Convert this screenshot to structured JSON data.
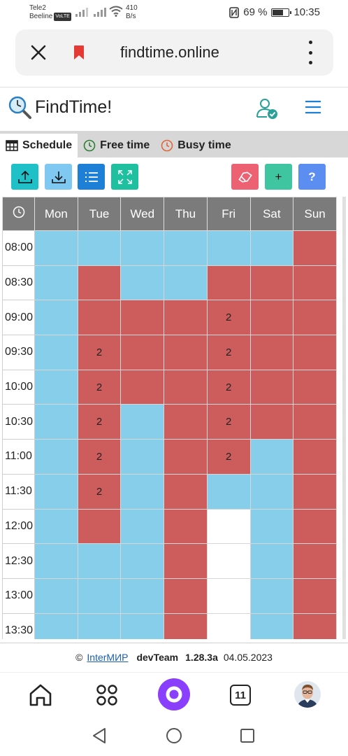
{
  "status_bar": {
    "carrier1": "Tele2",
    "carrier2": "Beeline",
    "volte": "VoLTE",
    "speed_value": "410",
    "speed_unit": "B/s",
    "battery": "69 %",
    "battery_level": 0.69,
    "time": "10:35"
  },
  "browser": {
    "url": "findtime.online"
  },
  "app": {
    "title": "FindTime!"
  },
  "tabs": [
    {
      "label": "Schedule",
      "icon": "table-icon",
      "active": true
    },
    {
      "label": "Free time",
      "icon": "clock-icon-green",
      "active": false
    },
    {
      "label": "Busy time",
      "icon": "clock-icon-orange",
      "active": false
    }
  ],
  "toolbar": {
    "add_label": "+",
    "help_label": "?"
  },
  "colors": {
    "free": "#87ceeb",
    "busy": "#cd5c5c",
    "empty": "#ffffff",
    "header": "#7b7b7b",
    "upload": "#20c0c8",
    "download": "#7ec8f2",
    "list": "#1e7fd6",
    "expand": "#1fc0a0",
    "eraser": "#ec6272",
    "add": "#3fc5a0",
    "help": "#5b8ef0"
  },
  "grid": {
    "columns": [
      "Mon",
      "Tue",
      "Wed",
      "Thu",
      "Fri",
      "Sat",
      "Sun"
    ],
    "rows": [
      {
        "time": "08:00",
        "cells": [
          "f",
          "f",
          "f",
          "f",
          "f",
          "f",
          "b"
        ],
        "labels": [
          "",
          "",
          "",
          "",
          "",
          "",
          ""
        ]
      },
      {
        "time": "08:30",
        "cells": [
          "f",
          "b",
          "f",
          "f",
          "b",
          "b",
          "b"
        ],
        "labels": [
          "",
          "",
          "",
          "",
          "",
          "",
          ""
        ]
      },
      {
        "time": "09:00",
        "cells": [
          "f",
          "b",
          "b",
          "b",
          "b",
          "b",
          "b"
        ],
        "labels": [
          "",
          "",
          "",
          "",
          "2",
          "",
          ""
        ]
      },
      {
        "time": "09:30",
        "cells": [
          "f",
          "b",
          "b",
          "b",
          "b",
          "b",
          "b"
        ],
        "labels": [
          "",
          "2",
          "",
          "",
          "2",
          "",
          ""
        ]
      },
      {
        "time": "10:00",
        "cells": [
          "f",
          "b",
          "b",
          "b",
          "b",
          "b",
          "b"
        ],
        "labels": [
          "",
          "2",
          "",
          "",
          "2",
          "",
          ""
        ]
      },
      {
        "time": "10:30",
        "cells": [
          "f",
          "b",
          "f",
          "b",
          "b",
          "b",
          "b"
        ],
        "labels": [
          "",
          "2",
          "",
          "",
          "2",
          "",
          ""
        ]
      },
      {
        "time": "11:00",
        "cells": [
          "f",
          "b",
          "f",
          "b",
          "b",
          "f",
          "b"
        ],
        "labels": [
          "",
          "2",
          "",
          "",
          "2",
          "",
          ""
        ]
      },
      {
        "time": "11:30",
        "cells": [
          "f",
          "b",
          "f",
          "b",
          "f",
          "f",
          "b"
        ],
        "labels": [
          "",
          "2",
          "",
          "",
          "",
          "",
          ""
        ]
      },
      {
        "time": "12:00",
        "cells": [
          "f",
          "b",
          "f",
          "b",
          "e",
          "f",
          "b"
        ],
        "labels": [
          "",
          "",
          "",
          "",
          "",
          "",
          ""
        ]
      },
      {
        "time": "12:30",
        "cells": [
          "f",
          "f",
          "f",
          "b",
          "e",
          "f",
          "b"
        ],
        "labels": [
          "",
          "",
          "",
          "",
          "",
          "",
          ""
        ]
      },
      {
        "time": "13:00",
        "cells": [
          "f",
          "f",
          "f",
          "b",
          "e",
          "f",
          "b"
        ],
        "labels": [
          "",
          "",
          "",
          "",
          "",
          "",
          ""
        ]
      },
      {
        "time": "13:30",
        "cells": [
          "f",
          "f",
          "f",
          "b",
          "e",
          "f",
          "b"
        ],
        "labels": [
          "",
          "",
          "",
          "",
          "",
          "",
          ""
        ]
      }
    ]
  },
  "footer": {
    "copyright": "©",
    "link": "InterМИР",
    "team": "devTeam",
    "version": "1.28.3a",
    "date": "04.05.2023"
  },
  "browser_nav": {
    "tabs_count": "11"
  }
}
